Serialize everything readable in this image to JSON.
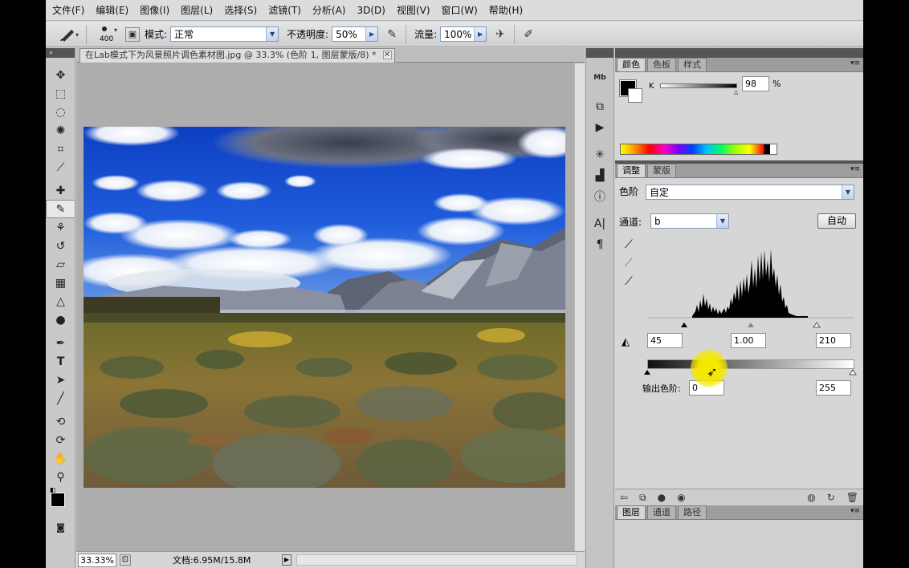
{
  "menu": [
    "文件(F)",
    "编辑(E)",
    "图像(I)",
    "图层(L)",
    "选择(S)",
    "滤镜(T)",
    "分析(A)",
    "3D(D)",
    "视图(V)",
    "窗口(W)",
    "帮助(H)"
  ],
  "options": {
    "brush_size": "400",
    "mode_label": "模式:",
    "mode_value": "正常",
    "opacity_label": "不透明度:",
    "opacity_value": "50%",
    "flow_label": "流量:",
    "flow_value": "100%"
  },
  "document": {
    "tab_title": "在Lab模式下为风景照片调色素材图.jpg @ 33.3% (色阶 1, 图层蒙版/8) *",
    "zoom": "33.33%",
    "doc_size": "文档:6.95M/15.8M"
  },
  "color_panel": {
    "tabs": [
      "颜色",
      "色板",
      "样式"
    ],
    "channel": "K",
    "value": "98",
    "unit": "%"
  },
  "adjustments_panel": {
    "tabs": [
      "调整",
      "蒙版"
    ],
    "title": "色阶",
    "preset": "自定",
    "channel_label": "通道:",
    "channel_value": "b",
    "auto_button": "自动",
    "input_black": "45",
    "input_gamma": "1.00",
    "input_white": "210",
    "output_label": "输出色阶:",
    "output_black": "0",
    "output_white": "255"
  },
  "layers_panel": {
    "tabs": [
      "图层",
      "通道",
      "路径"
    ]
  },
  "colors": {
    "sky": "#1a4fd0",
    "photoshop_bg": "#a8a8a8",
    "panel": "#d6d6d6",
    "cursor_highlight": "#f5e800"
  }
}
